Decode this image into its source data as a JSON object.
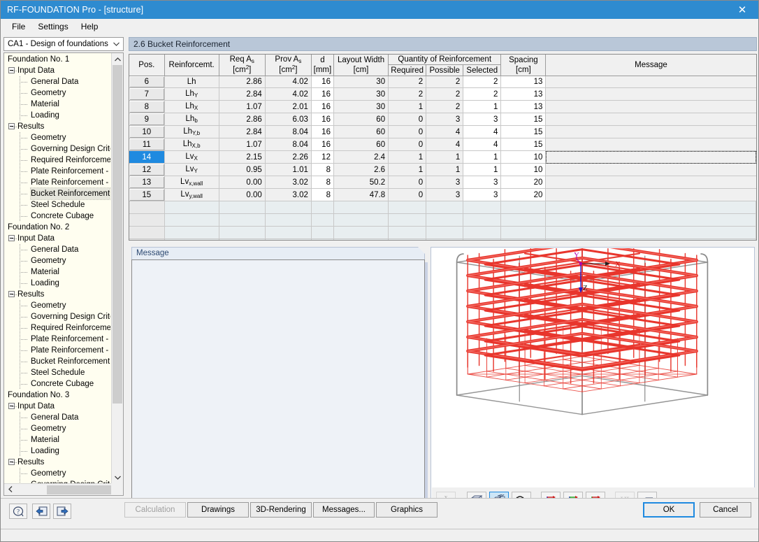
{
  "window": {
    "title": "RF-FOUNDATION Pro - [structure]",
    "close_label": "✕",
    "titlebar_color": "#2e8bd0"
  },
  "menu": {
    "items": [
      "File",
      "Settings",
      "Help"
    ]
  },
  "combo": {
    "value": "CA1 - Design of foundations",
    "arrow": "⌄"
  },
  "tree": {
    "nodes": [
      {
        "level": 0,
        "label": "Foundation No. 1",
        "expander": false,
        "selected": false
      },
      {
        "level": 1,
        "label": "Input Data",
        "expander": true,
        "selected": false
      },
      {
        "level": 2,
        "label": "General Data",
        "expander": false,
        "selected": false
      },
      {
        "level": 2,
        "label": "Geometry",
        "expander": false,
        "selected": false
      },
      {
        "level": 2,
        "label": "Material",
        "expander": false,
        "selected": false
      },
      {
        "level": 2,
        "label": "Loading",
        "expander": false,
        "selected": false
      },
      {
        "level": 1,
        "label": "Results",
        "expander": true,
        "selected": false
      },
      {
        "level": 2,
        "label": "Geometry",
        "expander": false,
        "selected": false
      },
      {
        "level": 2,
        "label": "Governing Design Criter",
        "expander": false,
        "selected": false
      },
      {
        "level": 2,
        "label": "Required Reinforcemen",
        "expander": false,
        "selected": false
      },
      {
        "level": 2,
        "label": "Plate Reinforcement - B",
        "expander": false,
        "selected": false
      },
      {
        "level": 2,
        "label": "Plate Reinforcement - T",
        "expander": false,
        "selected": false
      },
      {
        "level": 2,
        "label": "Bucket Reinforcement",
        "expander": false,
        "selected": true
      },
      {
        "level": 2,
        "label": "Steel Schedule",
        "expander": false,
        "selected": false
      },
      {
        "level": 2,
        "label": "Concrete Cubage",
        "expander": false,
        "selected": false
      },
      {
        "level": 0,
        "label": "Foundation No. 2",
        "expander": false,
        "selected": false
      },
      {
        "level": 1,
        "label": "Input Data",
        "expander": true,
        "selected": false
      },
      {
        "level": 2,
        "label": "General Data",
        "expander": false,
        "selected": false
      },
      {
        "level": 2,
        "label": "Geometry",
        "expander": false,
        "selected": false
      },
      {
        "level": 2,
        "label": "Material",
        "expander": false,
        "selected": false
      },
      {
        "level": 2,
        "label": "Loading",
        "expander": false,
        "selected": false
      },
      {
        "level": 1,
        "label": "Results",
        "expander": true,
        "selected": false
      },
      {
        "level": 2,
        "label": "Geometry",
        "expander": false,
        "selected": false
      },
      {
        "level": 2,
        "label": "Governing Design Criter",
        "expander": false,
        "selected": false
      },
      {
        "level": 2,
        "label": "Required Reinforcemen",
        "expander": false,
        "selected": false
      },
      {
        "level": 2,
        "label": "Plate Reinforcement - B",
        "expander": false,
        "selected": false
      },
      {
        "level": 2,
        "label": "Plate Reinforcement - T",
        "expander": false,
        "selected": false
      },
      {
        "level": 2,
        "label": "Bucket Reinforcement",
        "expander": false,
        "selected": false
      },
      {
        "level": 2,
        "label": "Steel Schedule",
        "expander": false,
        "selected": false
      },
      {
        "level": 2,
        "label": "Concrete Cubage",
        "expander": false,
        "selected": false
      },
      {
        "level": 0,
        "label": "Foundation No. 3",
        "expander": false,
        "selected": false
      },
      {
        "level": 1,
        "label": "Input Data",
        "expander": true,
        "selected": false
      },
      {
        "level": 2,
        "label": "General Data",
        "expander": false,
        "selected": false
      },
      {
        "level": 2,
        "label": "Geometry",
        "expander": false,
        "selected": false
      },
      {
        "level": 2,
        "label": "Material",
        "expander": false,
        "selected": false
      },
      {
        "level": 2,
        "label": "Loading",
        "expander": false,
        "selected": false
      },
      {
        "level": 1,
        "label": "Results",
        "expander": true,
        "selected": false
      },
      {
        "level": 2,
        "label": "Geometry",
        "expander": false,
        "selected": false
      },
      {
        "level": 2,
        "label": "Governing Design Criter",
        "expander": false,
        "selected": false
      }
    ]
  },
  "pane": {
    "header": "2.6 Bucket Reinforcement"
  },
  "table": {
    "headers": {
      "pos": "Pos.",
      "reinforcement": "Reinforcemt.",
      "req_as_1": "Req A",
      "req_as_sub": "s",
      "req_as_unit": "[cm",
      "req_as_unit_sup": "2",
      "req_as_unit_end": "]",
      "prov_as_1": "Prov A",
      "prov_as_sub": "s",
      "d": "d",
      "d_unit": "[mm]",
      "layout_width": "Layout Width",
      "layout_width_unit": "[cm]",
      "quantity_group": "Quantity of Reinforcement",
      "required": "Required",
      "possible": "Possible",
      "selected": "Selected",
      "spacing": "Spacing",
      "spacing_unit": "[cm]",
      "message": "Message"
    },
    "rows": [
      {
        "pos": "6",
        "label_main": "Lh",
        "label_sub": "",
        "req": "2.86",
        "prov": "4.02",
        "d": "16",
        "width": "30",
        "required": "2",
        "possible": "2",
        "selected_qty": "2",
        "spacing": "13",
        "message": "",
        "selected": false,
        "focus": false
      },
      {
        "pos": "7",
        "label_main": "Lh",
        "label_sub": "Y",
        "req": "2.84",
        "prov": "4.02",
        "d": "16",
        "width": "30",
        "required": "2",
        "possible": "2",
        "selected_qty": "2",
        "spacing": "13",
        "message": "",
        "selected": false,
        "focus": false
      },
      {
        "pos": "8",
        "label_main": "Lh",
        "label_sub": "X",
        "req": "1.07",
        "prov": "2.01",
        "d": "16",
        "width": "30",
        "required": "1",
        "possible": "2",
        "selected_qty": "1",
        "spacing": "13",
        "message": "",
        "selected": false,
        "focus": false
      },
      {
        "pos": "9",
        "label_main": "Lh",
        "label_sub": "b",
        "req": "2.86",
        "prov": "6.03",
        "d": "16",
        "width": "60",
        "required": "0",
        "possible": "3",
        "selected_qty": "3",
        "spacing": "15",
        "message": "",
        "selected": false,
        "focus": false
      },
      {
        "pos": "10",
        "label_main": "Lh",
        "label_sub": "Y,b",
        "req": "2.84",
        "prov": "8.04",
        "d": "16",
        "width": "60",
        "required": "0",
        "possible": "4",
        "selected_qty": "4",
        "spacing": "15",
        "message": "",
        "selected": false,
        "focus": false
      },
      {
        "pos": "11",
        "label_main": "Lh",
        "label_sub": "X,b",
        "req": "1.07",
        "prov": "8.04",
        "d": "16",
        "width": "60",
        "required": "0",
        "possible": "4",
        "selected_qty": "4",
        "spacing": "15",
        "message": "",
        "selected": false,
        "focus": false
      },
      {
        "pos": "14",
        "label_main": "Lv",
        "label_sub": "X",
        "req": "2.15",
        "prov": "2.26",
        "d": "12",
        "width": "2.4",
        "required": "1",
        "possible": "1",
        "selected_qty": "1",
        "spacing": "10",
        "message": "",
        "selected": true,
        "focus": true
      },
      {
        "pos": "12",
        "label_main": "Lv",
        "label_sub": "Y",
        "req": "0.95",
        "prov": "1.01",
        "d": "8",
        "width": "2.6",
        "required": "1",
        "possible": "1",
        "selected_qty": "1",
        "spacing": "10",
        "message": "",
        "selected": false,
        "focus": false
      },
      {
        "pos": "13",
        "label_main": "Lv",
        "label_sub": "x,wall",
        "req": "0.00",
        "prov": "3.02",
        "d": "8",
        "width": "50.2",
        "required": "0",
        "possible": "3",
        "selected_qty": "3",
        "spacing": "20",
        "message": "",
        "selected": false,
        "focus": false
      },
      {
        "pos": "15",
        "label_main": "Lv",
        "label_sub": "y,wall",
        "req": "0.00",
        "prov": "3.02",
        "d": "8",
        "width": "47.8",
        "required": "0",
        "possible": "3",
        "selected_qty": "3",
        "spacing": "20",
        "message": "",
        "selected": false,
        "focus": false
      }
    ]
  },
  "message_panel": {
    "tab_label": "Message",
    "content": ""
  },
  "view3d": {
    "axis_x": "X",
    "axis_y": "Y",
    "axis_z": "Z",
    "rebar_color": "#e8352c",
    "formwork_color": "#8a8a8a",
    "toolbar": [
      {
        "name": "dimension-icon",
        "label": "X",
        "enabled": false,
        "active": false
      },
      {
        "name": "wireframe-cube-icon",
        "label": "cube",
        "enabled": true,
        "active": false
      },
      {
        "name": "solid-cube-icon",
        "label": "cube",
        "enabled": true,
        "active": true
      },
      {
        "name": "rotate-view-icon",
        "label": "rot",
        "enabled": true,
        "active": false
      },
      {
        "name": "view-x-axis-icon",
        "label": "X",
        "enabled": true,
        "active": false
      },
      {
        "name": "view-y-axis-icon",
        "label": "-Y",
        "enabled": true,
        "active": false
      },
      {
        "name": "view-z-axis-icon",
        "label": "Z",
        "enabled": true,
        "active": false
      },
      {
        "name": "decimal-places-icon",
        "label": "x.xx",
        "enabled": false,
        "active": false
      },
      {
        "name": "print-icon",
        "label": "print",
        "enabled": true,
        "active": false
      }
    ]
  },
  "bottom": {
    "icon_buttons": [
      {
        "name": "help-icon",
        "glyph": "?"
      },
      {
        "name": "prev-module-icon",
        "glyph": "←"
      },
      {
        "name": "next-module-icon",
        "glyph": "→"
      }
    ],
    "buttons": [
      {
        "label": "Calculation",
        "disabled": true
      },
      {
        "label": "Drawings",
        "disabled": false
      },
      {
        "label": "3D-Rendering",
        "disabled": false
      },
      {
        "label": "Messages...",
        "disabled": false
      },
      {
        "label": "Graphics",
        "disabled": false
      }
    ],
    "ok_label": "OK",
    "cancel_label": "Cancel"
  }
}
